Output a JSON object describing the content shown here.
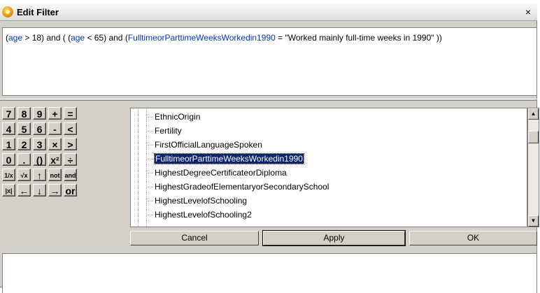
{
  "window": {
    "title": "Edit Filter",
    "close_glyph": "×"
  },
  "expression": {
    "parts": [
      {
        "text": "(",
        "kw": false
      },
      {
        "text": "age",
        "kw": true
      },
      {
        "text": " > 18) and ( (",
        "kw": false
      },
      {
        "text": "age",
        "kw": true
      },
      {
        "text": " < 65) and (",
        "kw": false
      },
      {
        "text": "FulltimeorParttimeWeeksWorkedin1990",
        "kw": true
      },
      {
        "text": " = \"Worked mainly full-time weeks in 1990\" ))",
        "kw": false
      }
    ]
  },
  "keypad": {
    "rows": [
      [
        "7",
        "8",
        "9",
        "+",
        "="
      ],
      [
        "4",
        "5",
        "6",
        "-",
        "<"
      ],
      [
        "1",
        "2",
        "3",
        "×",
        ">"
      ],
      [
        "0",
        ".",
        "()",
        "x²",
        "÷"
      ],
      [
        "1/x",
        "√x",
        "↑",
        "not",
        "and"
      ],
      [
        "|x|",
        "←",
        "↓",
        "→",
        "or"
      ]
    ]
  },
  "tree": {
    "items": [
      "EthnicOrigin",
      "Fertility",
      "FirstOfficialLanguageSpoken",
      "FulltimeorParttimeWeeksWorkedin1990",
      "HighestDegreeCertificateorDiploma",
      "HighestGradeofElementaryorSecondarySchool",
      "HighestLevelofSchooling",
      "HighestLevelofSchooling2"
    ],
    "selected_index": 3
  },
  "scrollbar": {
    "up_glyph": "▲",
    "down_glyph": "▼"
  },
  "buttons": {
    "cancel": "Cancel",
    "apply": "Apply",
    "ok": "OK"
  }
}
